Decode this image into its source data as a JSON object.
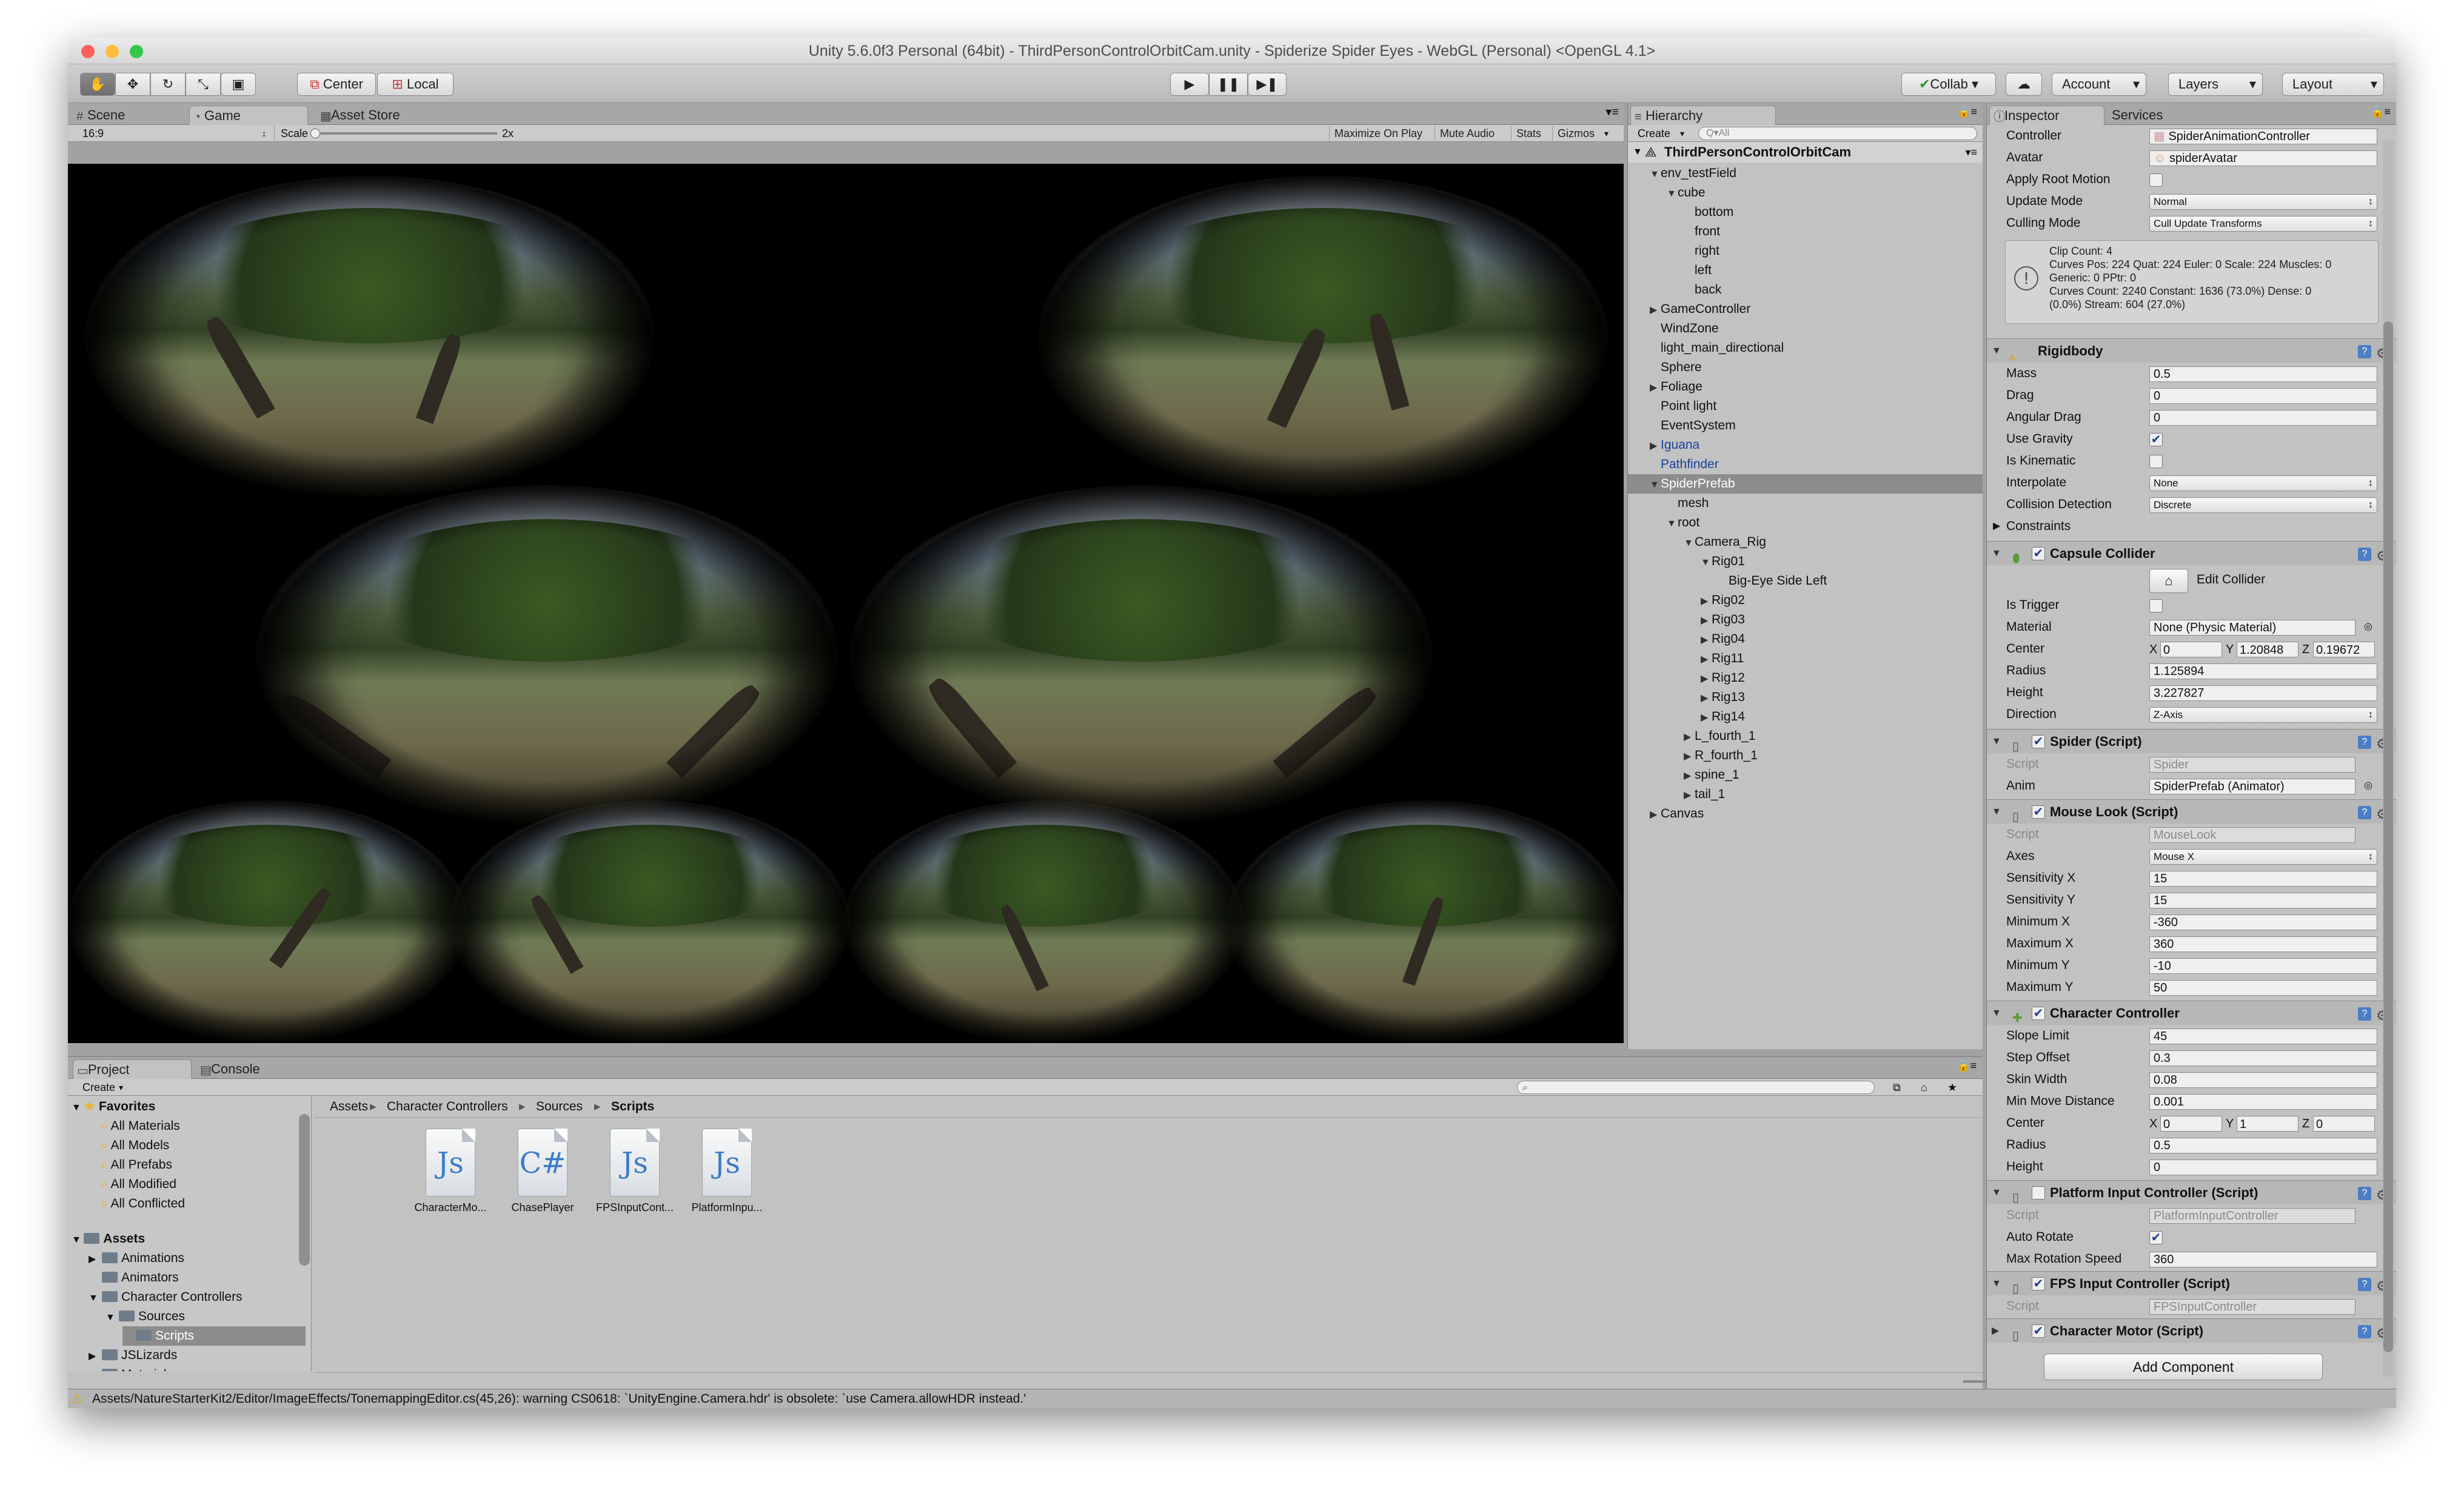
{
  "title": "Unity 5.6.0f3 Personal (64bit) - ThirdPersonControlOrbitCam.unity - Spiderize Spider Eyes - WebGL (Personal) <OpenGL 4.1>",
  "toolbar": {
    "center": "Center",
    "local": "Local",
    "collab": "Collab",
    "account": "Account",
    "layers": "Layers",
    "layout": "Layout",
    "play_icon": "play-icon",
    "pause_icon": "pause-icon",
    "step_icon": "step-icon"
  },
  "scene_tabs": [
    "Scene",
    "Game",
    "Asset Store"
  ],
  "game_bar": {
    "aspect": "16:9",
    "scale_label": "Scale",
    "scale_value": "2x",
    "maximize": "Maximize On Play",
    "mute": "Mute Audio",
    "stats": "Stats",
    "gizmos": "Gizmos"
  },
  "hierarchy": {
    "tab": "Hierarchy",
    "create": "Create",
    "search": "Q▾All",
    "root": "ThirdPersonControlOrbitCam",
    "items": [
      {
        "label": "env_testField",
        "depth": 1,
        "arrow": "▼"
      },
      {
        "label": "cube",
        "depth": 2,
        "arrow": "▼"
      },
      {
        "label": "bottom",
        "depth": 3,
        "arrow": ""
      },
      {
        "label": "front",
        "depth": 3,
        "arrow": ""
      },
      {
        "label": "right",
        "depth": 3,
        "arrow": ""
      },
      {
        "label": "left",
        "depth": 3,
        "arrow": ""
      },
      {
        "label": "back",
        "depth": 3,
        "arrow": ""
      },
      {
        "label": "GameController",
        "depth": 1,
        "arrow": "▶"
      },
      {
        "label": "WindZone",
        "depth": 1,
        "arrow": ""
      },
      {
        "label": "light_main_directional",
        "depth": 1,
        "arrow": ""
      },
      {
        "label": "Sphere",
        "depth": 1,
        "arrow": ""
      },
      {
        "label": "Foliage",
        "depth": 1,
        "arrow": "▶"
      },
      {
        "label": "Point light",
        "depth": 1,
        "arrow": ""
      },
      {
        "label": "EventSystem",
        "depth": 1,
        "arrow": ""
      },
      {
        "label": "Iguana",
        "depth": 1,
        "arrow": "▶",
        "style": "blue"
      },
      {
        "label": "Pathfinder",
        "depth": 1,
        "arrow": "",
        "style": "blue"
      },
      {
        "label": "SpiderPrefab",
        "depth": 1,
        "arrow": "▼",
        "style": "sel"
      },
      {
        "label": "mesh",
        "depth": 2,
        "arrow": ""
      },
      {
        "label": "root",
        "depth": 2,
        "arrow": "▼"
      },
      {
        "label": "Camera_Rig",
        "depth": 3,
        "arrow": "▼"
      },
      {
        "label": "Rig01",
        "depth": 4,
        "arrow": "▼"
      },
      {
        "label": "Big-Eye Side Left",
        "depth": 5,
        "arrow": ""
      },
      {
        "label": "Rig02",
        "depth": 4,
        "arrow": "▶"
      },
      {
        "label": "Rig03",
        "depth": 4,
        "arrow": "▶"
      },
      {
        "label": "Rig04",
        "depth": 4,
        "arrow": "▶"
      },
      {
        "label": "Rig11",
        "depth": 4,
        "arrow": "▶"
      },
      {
        "label": "Rig12",
        "depth": 4,
        "arrow": "▶"
      },
      {
        "label": "Rig13",
        "depth": 4,
        "arrow": "▶"
      },
      {
        "label": "Rig14",
        "depth": 4,
        "arrow": "▶"
      },
      {
        "label": "L_fourth_1",
        "depth": 3,
        "arrow": "▶"
      },
      {
        "label": "R_fourth_1",
        "depth": 3,
        "arrow": "▶"
      },
      {
        "label": "spine_1",
        "depth": 3,
        "arrow": "▶"
      },
      {
        "label": "tail_1",
        "depth": 3,
        "arrow": "▶"
      },
      {
        "label": "Canvas",
        "depth": 1,
        "arrow": "▶"
      }
    ]
  },
  "inspector": {
    "tabs": [
      "Inspector",
      "Services"
    ],
    "animator": {
      "controller_label": "Controller",
      "controller_value": "SpiderAnimationController",
      "avatar_label": "Avatar",
      "avatar_value": "spiderAvatar",
      "root_motion_label": "Apply Root Motion",
      "update_mode_label": "Update Mode",
      "update_mode_value": "Normal",
      "culling_label": "Culling Mode",
      "culling_value": "Cull Update Transforms",
      "info": [
        "Clip Count: 4",
        "Curves Pos: 224 Quat: 224 Euler: 0 Scale: 224 Muscles: 0",
        "Generic: 0 PPtr: 0",
        "Curves Count: 2240 Constant: 1636 (73.0%) Dense: 0",
        "(0.0%) Stream: 604 (27.0%)"
      ]
    },
    "rigidbody": {
      "title": "Rigidbody",
      "mass_label": "Mass",
      "mass": "0.5",
      "drag_label": "Drag",
      "drag": "0",
      "angular_label": "Angular Drag",
      "angular": "0",
      "gravity_label": "Use Gravity",
      "kinematic_label": "Is Kinematic",
      "interp_label": "Interpolate",
      "interp": "None",
      "collision_label": "Collision Detection",
      "collision": "Discrete",
      "constraints_label": "Constraints"
    },
    "capsule": {
      "title": "Capsule Collider",
      "edit": "Edit Collider",
      "trigger_label": "Is Trigger",
      "material_label": "Material",
      "material": "None (Physic Material)",
      "center_label": "Center",
      "cx": "0",
      "cy": "1.20848",
      "cz": "0.19672",
      "radius_label": "Radius",
      "radius": "1.125894",
      "height_label": "Height",
      "height": "3.227827",
      "direction_label": "Direction",
      "direction": "Z-Axis"
    },
    "spider": {
      "title": "Spider (Script)",
      "script_label": "Script",
      "script": "Spider",
      "anim_label": "Anim",
      "anim": "SpiderPrefab (Animator)"
    },
    "mouselook": {
      "title": "Mouse Look (Script)",
      "script_label": "Script",
      "script": "MouseLook",
      "axes_label": "Axes",
      "axes": "Mouse X",
      "sensx_label": "Sensitivity X",
      "sensx": "15",
      "sensy_label": "Sensitivity Y",
      "sensy": "15",
      "minx_label": "Minimum X",
      "minx": "-360",
      "maxx_label": "Maximum X",
      "maxx": "360",
      "miny_label": "Minimum Y",
      "miny": "-10",
      "maxy_label": "Maximum Y",
      "maxy": "50"
    },
    "charcontroller": {
      "title": "Character Controller",
      "slope_label": "Slope Limit",
      "slope": "45",
      "step_label": "Step Offset",
      "step": "0.3",
      "skin_label": "Skin Width",
      "skin": "0.08",
      "minmove_label": "Min Move Distance",
      "minmove": "0.001",
      "center_label": "Center",
      "cx": "0",
      "cy": "1",
      "cz": "0",
      "radius_label": "Radius",
      "radius": "0.5",
      "height_label": "Height",
      "height": "0"
    },
    "platform": {
      "title": "Platform Input Controller (Script)",
      "script_label": "Script",
      "script": "PlatformInputController",
      "autorotate_label": "Auto Rotate",
      "maxrot_label": "Max Rotation Speed",
      "maxrot": "360"
    },
    "fps": {
      "title": "FPS Input Controller (Script)",
      "script_label": "Script",
      "script": "FPSInputController"
    },
    "motor": {
      "title": "Character Motor (Script)"
    },
    "add_component": "Add Component"
  },
  "project": {
    "tabs": [
      "Project",
      "Console"
    ],
    "create": "Create",
    "favorites_title": "Favorites",
    "favorites": [
      "All Materials",
      "All Models",
      "All Prefabs",
      "All Modified",
      "All Conflicted"
    ],
    "assets_title": "Assets",
    "tree": [
      {
        "label": "Animations",
        "depth": 1,
        "arrow": "▶"
      },
      {
        "label": "Animators",
        "depth": 1,
        "arrow": ""
      },
      {
        "label": "Character Controllers",
        "depth": 1,
        "arrow": "▼"
      },
      {
        "label": "Sources",
        "depth": 2,
        "arrow": "▼"
      },
      {
        "label": "Scripts",
        "depth": 3,
        "arrow": ""
      },
      {
        "label": "JSLizards",
        "depth": 1,
        "arrow": "▶"
      },
      {
        "label": "Materials",
        "depth": 1,
        "arrow": ""
      }
    ],
    "breadcrumb": [
      "Assets",
      "Character Controllers",
      "Sources",
      "Scripts"
    ],
    "files": [
      {
        "name": "CharacterMo...",
        "glyph": "Js"
      },
      {
        "name": "ChasePlayer",
        "glyph": "C#"
      },
      {
        "name": "FPSInputCont...",
        "glyph": "Js"
      },
      {
        "name": "PlatformInpu...",
        "glyph": "Js"
      }
    ]
  },
  "status": "Assets/NatureStarterKit2/Editor/ImageEffects/TonemappingEditor.cs(45,26): warning CS0618: `UnityEngine.Camera.hdr' is obsolete: `use Camera.allowHDR instead.'",
  "colors": {
    "accent": "#4d7dc4",
    "selection": "#8c8c8c",
    "blue_text": "#1b3f9e"
  }
}
